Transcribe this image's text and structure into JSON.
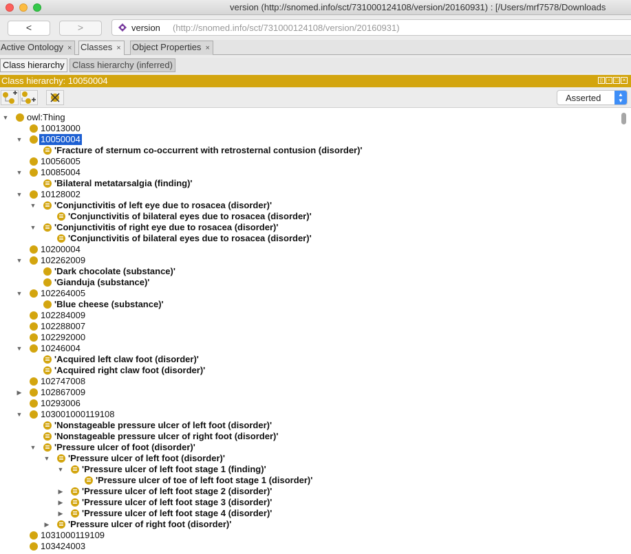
{
  "window": {
    "title": "version (http://snomed.info/sct/731000124108/version/20160931)  : [/Users/mrf7578/Downloads"
  },
  "nav": {
    "back_label": "<",
    "forward_label": ">",
    "ontology_name": "version",
    "ontology_iri": "(http://snomed.info/sct/731000124108/version/20160931)"
  },
  "tabs": [
    {
      "label": "Active Ontology",
      "close": "×"
    },
    {
      "label": "Classes",
      "close": "×"
    },
    {
      "label": "Object Properties",
      "close": "×"
    }
  ],
  "subtabs": [
    {
      "label": "Class hierarchy"
    },
    {
      "label": "Class hierarchy (inferred)"
    }
  ],
  "view": {
    "title": "Class hierarchy: 10050004",
    "mode": "Asserted"
  },
  "tree": [
    {
      "depth": 0,
      "exp": "open",
      "type": "plain",
      "label": "owl:Thing"
    },
    {
      "depth": 1,
      "exp": "none",
      "type": "plain",
      "label": "10013000"
    },
    {
      "depth": 1,
      "exp": "open",
      "type": "plain",
      "label": "10050004",
      "selected": true
    },
    {
      "depth": 2,
      "exp": "none",
      "type": "defined",
      "label": "'Fracture of sternum co-occurrent with retrosternal contusion (disorder)'"
    },
    {
      "depth": 1,
      "exp": "none",
      "type": "plain",
      "label": "10056005"
    },
    {
      "depth": 1,
      "exp": "open",
      "type": "plain",
      "label": "10085004"
    },
    {
      "depth": 2,
      "exp": "none",
      "type": "defined",
      "label": "'Bilateral metatarsalgia (finding)'"
    },
    {
      "depth": 1,
      "exp": "open",
      "type": "plain",
      "label": "10128002"
    },
    {
      "depth": 2,
      "exp": "open",
      "type": "defined",
      "label": "'Conjunctivitis of left eye due to rosacea (disorder)'"
    },
    {
      "depth": 3,
      "exp": "none",
      "type": "defined",
      "label": "'Conjunctivitis of bilateral eyes due to rosacea (disorder)'"
    },
    {
      "depth": 2,
      "exp": "open",
      "type": "defined",
      "label": "'Conjunctivitis of right eye due to rosacea (disorder)'"
    },
    {
      "depth": 3,
      "exp": "none",
      "type": "defined",
      "label": "'Conjunctivitis of bilateral eyes due to rosacea (disorder)'"
    },
    {
      "depth": 1,
      "exp": "none",
      "type": "plain",
      "label": "10200004"
    },
    {
      "depth": 1,
      "exp": "open",
      "type": "plain",
      "label": "102262009"
    },
    {
      "depth": 2,
      "exp": "none",
      "type": "plainbold",
      "label": "'Dark chocolate (substance)'"
    },
    {
      "depth": 2,
      "exp": "none",
      "type": "plainbold",
      "label": "'Gianduja (substance)'"
    },
    {
      "depth": 1,
      "exp": "open",
      "type": "plain",
      "label": "102264005"
    },
    {
      "depth": 2,
      "exp": "none",
      "type": "plainbold",
      "label": "'Blue cheese (substance)'"
    },
    {
      "depth": 1,
      "exp": "none",
      "type": "plain",
      "label": "102284009"
    },
    {
      "depth": 1,
      "exp": "none",
      "type": "plain",
      "label": "102288007"
    },
    {
      "depth": 1,
      "exp": "none",
      "type": "plain",
      "label": "102292000"
    },
    {
      "depth": 1,
      "exp": "open",
      "type": "plain",
      "label": "10246004"
    },
    {
      "depth": 2,
      "exp": "none",
      "type": "defined",
      "label": "'Acquired left claw foot (disorder)'"
    },
    {
      "depth": 2,
      "exp": "none",
      "type": "defined",
      "label": "'Acquired right claw foot (disorder)'"
    },
    {
      "depth": 1,
      "exp": "none",
      "type": "plain",
      "label": "102747008"
    },
    {
      "depth": 1,
      "exp": "closed",
      "type": "plain",
      "label": "102867009"
    },
    {
      "depth": 1,
      "exp": "none",
      "type": "plain",
      "label": "10293006"
    },
    {
      "depth": 1,
      "exp": "open",
      "type": "plain",
      "label": "103001000119108"
    },
    {
      "depth": 2,
      "exp": "none",
      "type": "defined",
      "label": "'Nonstageable pressure ulcer of left foot (disorder)'"
    },
    {
      "depth": 2,
      "exp": "none",
      "type": "defined",
      "label": "'Nonstageable pressure ulcer of right foot (disorder)'"
    },
    {
      "depth": 2,
      "exp": "open",
      "type": "defined",
      "label": "'Pressure ulcer of foot (disorder)'"
    },
    {
      "depth": 3,
      "exp": "open",
      "type": "defined",
      "label": "'Pressure ulcer of left foot (disorder)'"
    },
    {
      "depth": 4,
      "exp": "open",
      "type": "defined",
      "label": "'Pressure ulcer of left foot stage 1 (finding)'"
    },
    {
      "depth": 5,
      "exp": "none",
      "type": "defined",
      "label": "'Pressure ulcer of toe of left foot stage 1 (disorder)'"
    },
    {
      "depth": 4,
      "exp": "closed",
      "type": "defined",
      "label": "'Pressure ulcer of left foot stage 2 (disorder)'"
    },
    {
      "depth": 4,
      "exp": "closed",
      "type": "defined",
      "label": "'Pressure ulcer of left foot stage 3 (disorder)'"
    },
    {
      "depth": 4,
      "exp": "closed",
      "type": "defined",
      "label": "'Pressure ulcer of left foot stage 4 (disorder)'"
    },
    {
      "depth": 3,
      "exp": "closed",
      "type": "defined",
      "label": "'Pressure ulcer of right foot (disorder)'"
    },
    {
      "depth": 1,
      "exp": "none",
      "type": "plain",
      "label": "1031000119109"
    },
    {
      "depth": 1,
      "exp": "none",
      "type": "plain",
      "label": "103424003"
    }
  ]
}
